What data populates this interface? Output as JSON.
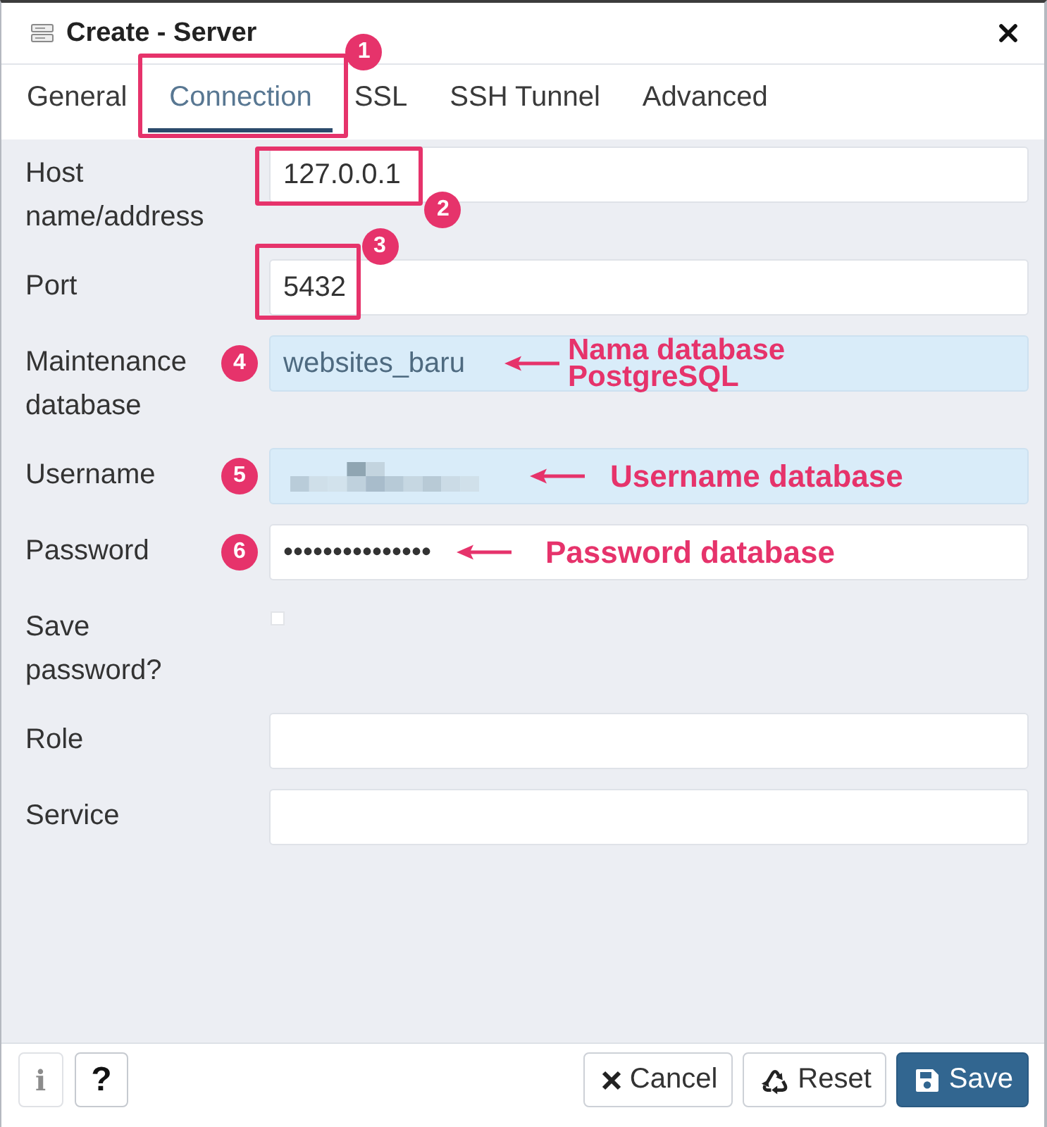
{
  "window": {
    "title": "Create - Server"
  },
  "tabs": [
    {
      "label": "General",
      "selected": false
    },
    {
      "label": "Connection",
      "selected": true,
      "callout": {
        "kind": "frame",
        "number": "1"
      }
    },
    {
      "label": "SSL",
      "selected": false
    },
    {
      "label": "SSH Tunnel",
      "selected": false
    },
    {
      "label": "Advanced",
      "selected": false
    }
  ],
  "fields": [
    {
      "kind": "text",
      "label": "Host name/address",
      "value": "127.0.0.1",
      "autofilled": false,
      "callout": {
        "kind": "frame",
        "number": "2"
      }
    },
    {
      "kind": "text",
      "label": "Port",
      "value": "5432",
      "autofilled": false,
      "callout": {
        "kind": "frame",
        "number": "3"
      }
    },
    {
      "kind": "text",
      "label": "Maintenance database",
      "value": "websites_baru",
      "autofilled": true,
      "callout": {
        "kind": "pointer",
        "number": "4",
        "note": "Nama database PostgreSQL"
      }
    },
    {
      "kind": "text",
      "label": "Username",
      "redacted": true,
      "autofilled": true,
      "callout": {
        "kind": "pointer",
        "number": "5",
        "note": "Username database"
      }
    },
    {
      "kind": "text",
      "label": "Password",
      "value": "•••••••••••••••",
      "autofilled": false,
      "callout": {
        "kind": "pointer",
        "number": "6",
        "note": "Password database"
      }
    },
    {
      "kind": "checkbox",
      "label": "Save password?",
      "checked": false
    },
    {
      "kind": "text",
      "label": "Role",
      "autofilled": false
    },
    {
      "kind": "text",
      "label": "Service",
      "autofilled": false
    }
  ],
  "footer": {
    "help_buttons": [
      {
        "glyph": "i",
        "disabled": true
      },
      {
        "glyph": "?",
        "disabled": false
      }
    ],
    "actions": [
      {
        "kind": "cancel",
        "label": "Cancel"
      },
      {
        "kind": "reset",
        "label": "Reset"
      },
      {
        "kind": "save",
        "label": "Save"
      }
    ]
  }
}
